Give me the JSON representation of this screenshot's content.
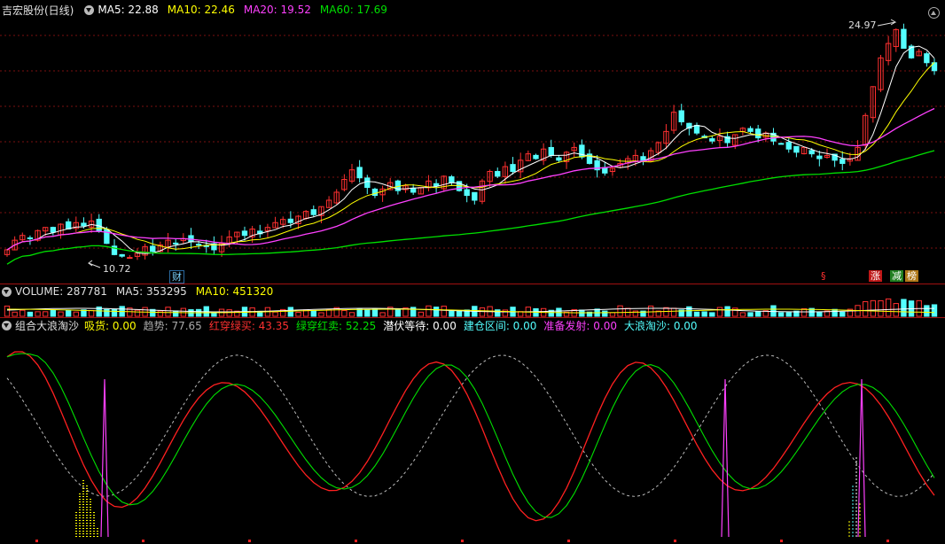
{
  "main_header": {
    "stock": "吉宏股份(日线)",
    "ma5": "MA5: 22.88",
    "ma10": "MA10: 22.46",
    "ma20": "MA20: 19.52",
    "ma60": "MA60: 17.69"
  },
  "main_annotations": {
    "high_label": "24.97",
    "low_label": "10.72",
    "tag_cai": "财",
    "tag_s": "§",
    "tag_zhang": "涨",
    "tag_jian": "减",
    "tag_bang": "榜"
  },
  "volume_header": {
    "volume": "VOLUME: 287781",
    "ma5": "MA5: 353295",
    "ma10": "MA10: 451320"
  },
  "indicator_header": {
    "name": "组合大浪淘沙",
    "xihuo": "吸货: 0.00",
    "qushi": "趋势: 77.65",
    "hongchuan": "红穿绿买: 43.35",
    "lvchuan": "绿穿红卖: 52.25",
    "qianfu": "潜伏等待: 0.00",
    "jiancang": "建仓区间: 0.00",
    "zhunbei": "准备发射: 0.00",
    "dalang": "大浪淘沙: 0.00"
  },
  "colors": {
    "up": "#ff3030",
    "down": "#54ffff",
    "ma5": "#ffffff",
    "ma10": "#ffff00",
    "ma20": "#ff40ff",
    "ma60": "#00e000",
    "grid": "#7a1010"
  },
  "chart_data": {
    "type": "candlestick",
    "ohlc_close": [
      11.2,
      11.8,
      12.1,
      11.9,
      12.4,
      12.6,
      12.3,
      12.8,
      12.5,
      12.9,
      12.7,
      13.0,
      12.4,
      11.6,
      10.9,
      10.8,
      10.72,
      11.0,
      11.4,
      11.1,
      11.5,
      11.8,
      11.6,
      11.9,
      11.7,
      11.5,
      11.4,
      11.2,
      11.6,
      12.0,
      12.3,
      12.1,
      12.5,
      12.2,
      12.6,
      12.9,
      13.1,
      12.9,
      13.3,
      13.6,
      13.4,
      13.9,
      14.3,
      14.8,
      15.6,
      16.2,
      15.7,
      15.1,
      14.6,
      15.0,
      15.4,
      14.9,
      15.2,
      14.8,
      15.1,
      15.5,
      15.2,
      15.8,
      15.4,
      14.9,
      14.6,
      14.3,
      15.5,
      16.1,
      15.8,
      16.4,
      16.1,
      16.8,
      17.2,
      16.9,
      17.5,
      17.1,
      16.8,
      17.3,
      17.6,
      17.0,
      16.6,
      16.2,
      16.0,
      16.3,
      16.6,
      16.9,
      17.1,
      16.8,
      17.4,
      17.9,
      18.6,
      19.8,
      19.2,
      18.8,
      18.5,
      18.2,
      18.0,
      18.3,
      17.9,
      18.4,
      18.8,
      18.6,
      18.2,
      18.5,
      18.0,
      17.8,
      17.5,
      17.3,
      17.6,
      17.2,
      16.9,
      17.1,
      16.8,
      16.6,
      16.9,
      17.6,
      19.6,
      21.4,
      23.2,
      24.1,
      24.97,
      23.8,
      23.2,
      23.6,
      22.9,
      22.4
    ]
  }
}
